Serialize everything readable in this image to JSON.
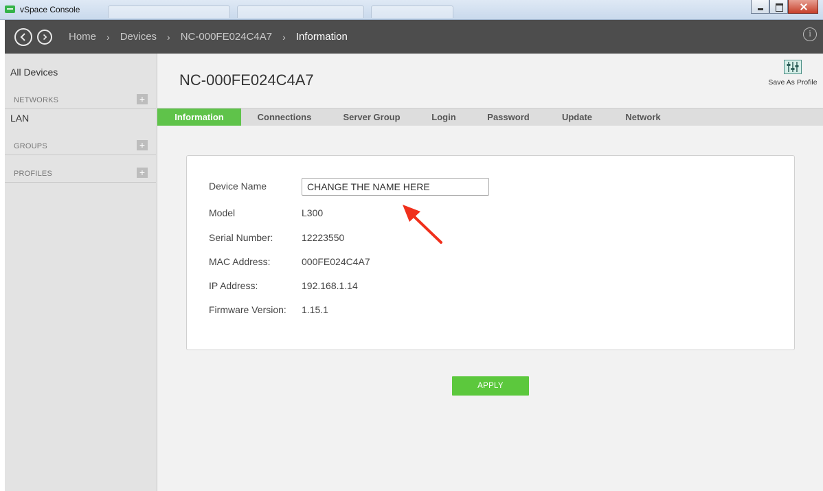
{
  "window": {
    "title": "vSpace Console"
  },
  "header": {
    "breadcrumbs": [
      "Home",
      "Devices",
      "NC-000FE024C4A7",
      "Information"
    ],
    "separator": "›"
  },
  "sidebar": {
    "all_devices": "All Devices",
    "sections": [
      {
        "label": "NETWORKS",
        "items": [
          "LAN"
        ]
      },
      {
        "label": "GROUPS",
        "items": []
      },
      {
        "label": "PROFILES",
        "items": []
      }
    ],
    "add_symbol": "+"
  },
  "main": {
    "title": "NC-000FE024C4A7",
    "save_as_profile": "Save As Profile",
    "tabs": [
      {
        "label": "Information",
        "active": true
      },
      {
        "label": "Connections",
        "active": false
      },
      {
        "label": "Server Group",
        "active": false
      },
      {
        "label": "Login",
        "active": false
      },
      {
        "label": "Password",
        "active": false
      },
      {
        "label": "Update",
        "active": false
      },
      {
        "label": "Network",
        "active": false
      }
    ],
    "fields": {
      "device_name": {
        "label": "Device Name",
        "value": "CHANGE THE NAME HERE"
      },
      "model": {
        "label": "Model",
        "value": "L300"
      },
      "serial": {
        "label": "Serial Number:",
        "value": "12223550"
      },
      "mac": {
        "label": "MAC Address:",
        "value": "000FE024C4A7"
      },
      "ip": {
        "label": "IP Address:",
        "value": "192.168.1.14"
      },
      "firmware": {
        "label": "Firmware Version:",
        "value": "1.15.1"
      }
    },
    "apply_label": "APPLY"
  },
  "colors": {
    "accent_green": "#5fc34a",
    "header_bg": "#4d4d4d",
    "sidebar_bg": "#e3e3e3",
    "annotation_arrow": "#f0301c"
  },
  "icons": {
    "back": "chevron-left-circle-icon",
    "forward": "chevron-right-circle-icon",
    "info": "info-icon",
    "save_profile": "sliders-icon",
    "annotation": "red-arrow-icon"
  }
}
